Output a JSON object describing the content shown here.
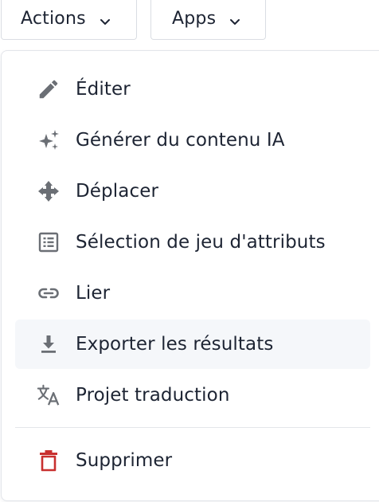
{
  "toolbar": {
    "actions_label": "Actions",
    "apps_label": "Apps"
  },
  "menu": {
    "items": [
      {
        "label": "Éditer",
        "icon": "pencil-icon"
      },
      {
        "label": "Générer du contenu IA",
        "icon": "sparkles-icon"
      },
      {
        "label": "Déplacer",
        "icon": "move-arrows-icon"
      },
      {
        "label": "Sélection de jeu d'attributs",
        "icon": "list-box-icon"
      },
      {
        "label": "Lier",
        "icon": "link-icon"
      },
      {
        "label": "Exporter les résultats",
        "icon": "download-icon"
      },
      {
        "label": "Projet traduction",
        "icon": "translate-icon"
      }
    ],
    "delete": {
      "label": "Supprimer",
      "icon": "trash-icon"
    }
  },
  "colors": {
    "icon": "#6b6f75",
    "text": "#1d2433",
    "danger": "#c8302f",
    "hover": "#f5f7fa",
    "border": "#dadde3"
  }
}
